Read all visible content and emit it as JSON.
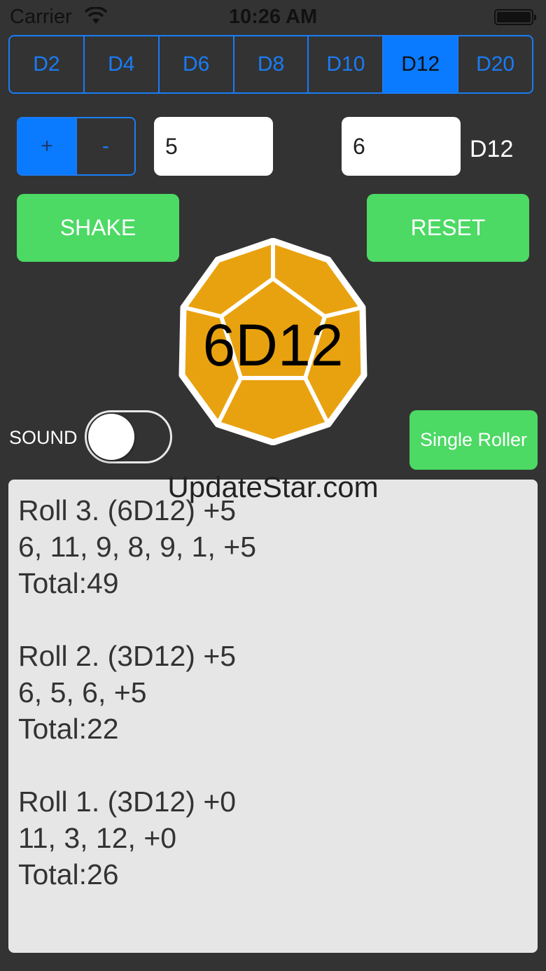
{
  "status_bar": {
    "carrier": "Carrier",
    "time": "10:26 AM"
  },
  "dice_types": {
    "items": [
      "D2",
      "D4",
      "D6",
      "D8",
      "D10",
      "D12",
      "D20"
    ],
    "selected": "D12"
  },
  "stepper": {
    "plus_label": "+",
    "minus_label": "-"
  },
  "modifier_field": {
    "value": "5"
  },
  "count_field": {
    "value": "6"
  },
  "die_label": "D12",
  "buttons": {
    "shake": "SHAKE",
    "reset": "RESET",
    "single_roller": "Single Roller"
  },
  "dice_display": {
    "label": "6D12",
    "color": "#e9a20f"
  },
  "sound": {
    "label": "SOUND",
    "on": false
  },
  "log": {
    "entries": [
      {
        "header": "Roll 3. (6D12) +5",
        "values": "6, 11, 9, 8, 9, 1, +5",
        "total": "Total:49"
      },
      {
        "header": "Roll 2. (3D12) +5",
        "values": "6, 5, 6, +5",
        "total": "Total:22"
      },
      {
        "header": "Roll 1. (3D12) +0",
        "values": "11, 3, 12, +0",
        "total": "Total:26"
      }
    ]
  },
  "watermark": "UpdateStar.com",
  "colors": {
    "accent": "#0a7aff",
    "green": "#4cd964",
    "background": "#333333"
  }
}
